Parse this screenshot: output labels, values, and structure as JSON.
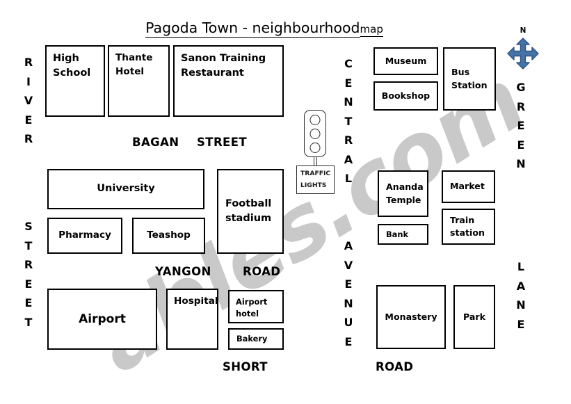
{
  "title": {
    "main": "Pagoda Town - neighbourhood",
    "sub": "map"
  },
  "compass": {
    "north_label": "N",
    "icon": "four-way-arrow-icon",
    "fill_color": "#4573a8",
    "stroke_color": "#2f5484"
  },
  "traffic_lights": {
    "icon": "traffic-light-icon",
    "label_line1": "TRAFFIC",
    "label_line2": "LIGHTS"
  },
  "streets": {
    "vertical": [
      {
        "name": "river",
        "text": "RIVER"
      },
      {
        "name": "street",
        "text": "STREET"
      },
      {
        "name": "central",
        "text": "CENTRAL"
      },
      {
        "name": "avenue",
        "text": "AVENUE"
      },
      {
        "name": "green",
        "text": "GREEN"
      },
      {
        "name": "lane",
        "text": "LANE"
      }
    ],
    "horizontal": [
      {
        "name": "bagan",
        "text": "BAGAN"
      },
      {
        "name": "street",
        "text": "STREET"
      },
      {
        "name": "yangon",
        "text": "YANGON"
      },
      {
        "name": "road",
        "text": "ROAD"
      },
      {
        "name": "short",
        "text": "SHORT"
      },
      {
        "name": "road2",
        "text": "ROAD"
      }
    ]
  },
  "buildings": [
    {
      "id": "high-school",
      "label": "High\nSchool"
    },
    {
      "id": "thante-hotel",
      "label": "Thante\nHotel"
    },
    {
      "id": "sanon-training-restaurant",
      "label": "Sanon Training\nRestaurant"
    },
    {
      "id": "university",
      "label": "University"
    },
    {
      "id": "pharmacy",
      "label": "Pharmacy"
    },
    {
      "id": "teashop",
      "label": "Teashop"
    },
    {
      "id": "football-stadium",
      "label": "Football\nstadium"
    },
    {
      "id": "airport",
      "label": "Airport"
    },
    {
      "id": "hospital",
      "label": "Hospital"
    },
    {
      "id": "airport-hotel",
      "label": "Airport\nhotel"
    },
    {
      "id": "bakery",
      "label": "Bakery"
    },
    {
      "id": "museum",
      "label": "Museum"
    },
    {
      "id": "bookshop",
      "label": "Bookshop"
    },
    {
      "id": "bus-station",
      "label": "Bus\nStation"
    },
    {
      "id": "ananda-temple",
      "label": "Ananda\nTemple"
    },
    {
      "id": "bank",
      "label": "Bank"
    },
    {
      "id": "market",
      "label": "Market"
    },
    {
      "id": "train-station",
      "label": "Train\nstation"
    },
    {
      "id": "monastery",
      "label": "Monastery"
    },
    {
      "id": "park",
      "label": "Park"
    }
  ],
  "watermark": {
    "text": "ables.com",
    "color": "#c9c9c9"
  }
}
